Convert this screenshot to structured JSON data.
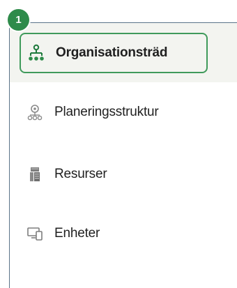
{
  "step_badge": "1",
  "nav": {
    "items": [
      {
        "label": "Organisationsträd",
        "icon": "org-tree-icon",
        "active": true
      },
      {
        "label": "Planeringsstruktur",
        "icon": "planning-structure-icon",
        "active": false
      },
      {
        "label": "Resurser",
        "icon": "resources-icon",
        "active": false
      },
      {
        "label": "Enheter",
        "icon": "devices-icon",
        "active": false
      }
    ]
  },
  "colors": {
    "accent": "#2e8b4a",
    "active_border": "#3f9a5b",
    "selected_background": "#f3f4f0",
    "panel_border": "#5a7388",
    "icon_gray": "#8a8a8a"
  }
}
